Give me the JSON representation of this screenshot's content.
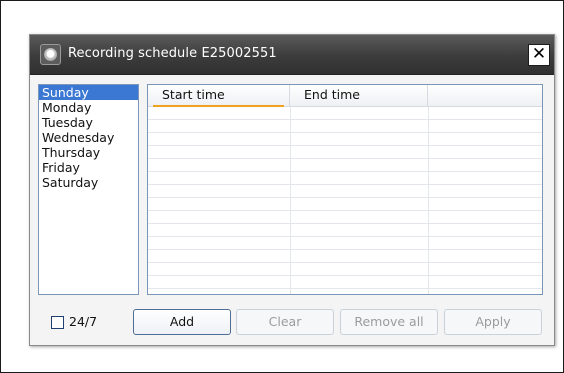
{
  "dialog": {
    "title": "Recording schedule E25002551",
    "close_label": "✕"
  },
  "days": {
    "items": [
      "Sunday",
      "Monday",
      "Tuesday",
      "Wednesday",
      "Thursday",
      "Friday",
      "Saturday"
    ],
    "selected": "Sunday"
  },
  "table": {
    "columns": [
      "Start time",
      "End time"
    ],
    "rows": []
  },
  "footer": {
    "always_label": "24/7",
    "always_checked": false,
    "add_label": "Add",
    "clear_label": "Clear",
    "remove_all_label": "Remove all",
    "apply_label": "Apply"
  }
}
